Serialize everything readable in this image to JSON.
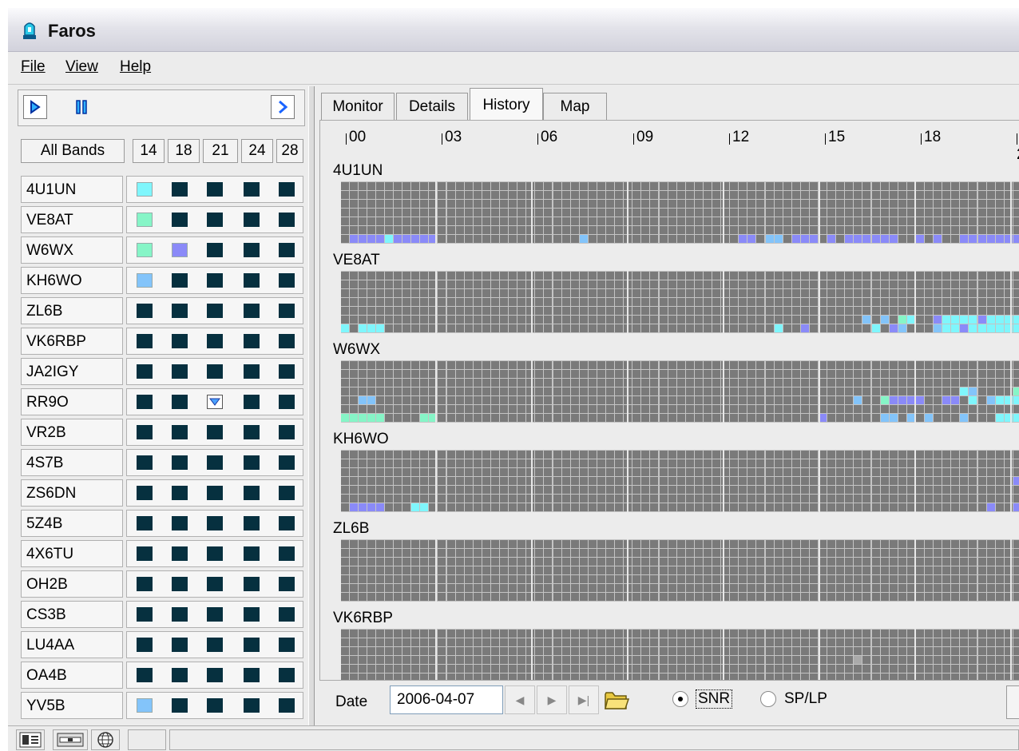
{
  "app": {
    "title": "Faros"
  },
  "menu": [
    {
      "label": "File"
    },
    {
      "label": "View"
    },
    {
      "label": "Help"
    }
  ],
  "toolbar": {
    "play": "play-icon",
    "pause": "pause-icon",
    "forward": "chevron-right-icon"
  },
  "bands": {
    "all_label": "All Bands",
    "columns": [
      "14",
      "18",
      "21",
      "24",
      "28"
    ]
  },
  "colors": {
    "dark_cell": "#06303f",
    "cyan": "#7ff6fc",
    "mint": "#86f5c7",
    "lavender": "#8a8af8",
    "skyblue": "#83c4fa",
    "grid_bg": "#7a7a7a",
    "grid_cell": "#8c8c8c",
    "grid_line": "#c4c4c4"
  },
  "stations": [
    {
      "name": "4U1UN",
      "cells": [
        "cyan",
        "dark",
        "dark",
        "dark",
        "dark"
      ]
    },
    {
      "name": "VE8AT",
      "cells": [
        "mint",
        "dark",
        "dark",
        "dark",
        "dark"
      ]
    },
    {
      "name": "W6WX",
      "cells": [
        "mint",
        "lavender",
        "dark",
        "dark",
        "dark"
      ]
    },
    {
      "name": "KH6WO",
      "cells": [
        "skyblue",
        "dark",
        "dark",
        "dark",
        "dark"
      ]
    },
    {
      "name": "ZL6B",
      "cells": [
        "dark",
        "dark",
        "dark",
        "dark",
        "dark"
      ]
    },
    {
      "name": "VK6RBP",
      "cells": [
        "dark",
        "dark",
        "dark",
        "dark",
        "dark"
      ]
    },
    {
      "name": "JA2IGY",
      "cells": [
        "dark",
        "dark",
        "dark",
        "dark",
        "dark"
      ]
    },
    {
      "name": "RR9O",
      "cells": [
        "dark",
        "dark",
        "arrow",
        "dark",
        "dark"
      ]
    },
    {
      "name": "VR2B",
      "cells": [
        "dark",
        "dark",
        "dark",
        "dark",
        "dark"
      ]
    },
    {
      "name": "4S7B",
      "cells": [
        "dark",
        "dark",
        "dark",
        "dark",
        "dark"
      ]
    },
    {
      "name": "ZS6DN",
      "cells": [
        "dark",
        "dark",
        "dark",
        "dark",
        "dark"
      ]
    },
    {
      "name": "5Z4B",
      "cells": [
        "dark",
        "dark",
        "dark",
        "dark",
        "dark"
      ]
    },
    {
      "name": "4X6TU",
      "cells": [
        "dark",
        "dark",
        "dark",
        "dark",
        "dark"
      ]
    },
    {
      "name": "OH2B",
      "cells": [
        "dark",
        "dark",
        "dark",
        "dark",
        "dark"
      ]
    },
    {
      "name": "CS3B",
      "cells": [
        "dark",
        "dark",
        "dark",
        "dark",
        "dark"
      ]
    },
    {
      "name": "LU4AA",
      "cells": [
        "dark",
        "dark",
        "dark",
        "dark",
        "dark"
      ]
    },
    {
      "name": "OA4B",
      "cells": [
        "dark",
        "dark",
        "dark",
        "dark",
        "dark"
      ]
    },
    {
      "name": "YV5B",
      "cells": [
        "skyblue",
        "dark",
        "dark",
        "dark",
        "dark"
      ]
    }
  ],
  "tabs": [
    {
      "label": "Monitor",
      "active": false
    },
    {
      "label": "Details",
      "active": false
    },
    {
      "label": "History",
      "active": true
    },
    {
      "label": "Map",
      "active": false
    }
  ],
  "history": {
    "hours": [
      "00",
      "03",
      "06",
      "09",
      "12",
      "15",
      "18",
      "2"
    ],
    "blocks": [
      {
        "station": "4U1UN"
      },
      {
        "station": "VE8AT"
      },
      {
        "station": "W6WX"
      },
      {
        "station": "KH6WO"
      },
      {
        "station": "ZL6B"
      },
      {
        "station": "VK6RBP"
      }
    ]
  },
  "footer": {
    "date_label": "Date",
    "date_value": "2006-04-07",
    "nav_prev": "triangle-left-icon",
    "nav_next": "triangle-right-icon",
    "nav_last": "skip-end-icon",
    "open_folder": "folder-icon",
    "radio_snr": "SNR",
    "radio_splp": "SP/LP",
    "selected_mode": "SNR"
  },
  "statusbar": {
    "icons": [
      "list-icon",
      "card-icon",
      "globe-icon"
    ]
  }
}
